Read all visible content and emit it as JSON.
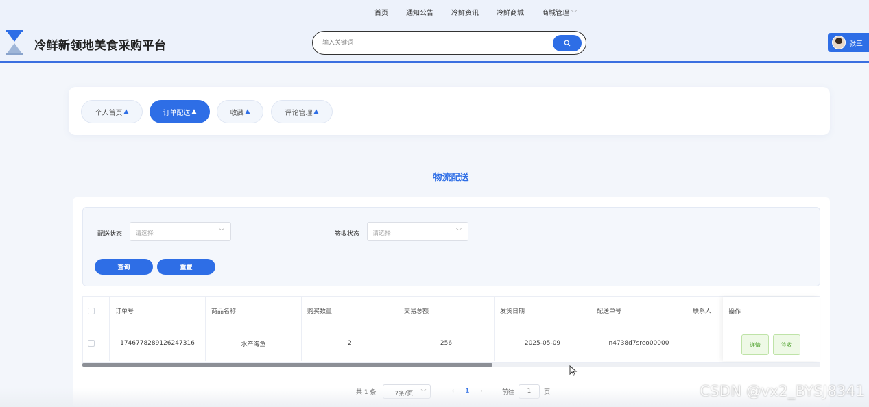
{
  "header": {
    "site_title": "冷鲜新领地美食采购平台",
    "nav": [
      "首页",
      "通知公告",
      "冷鲜资讯",
      "冷鲜商城",
      "商城管理"
    ],
    "search_placeholder": "输入关键词",
    "user_name": "张三"
  },
  "tabs": [
    {
      "label": "个人首页",
      "active": false
    },
    {
      "label": "订单配送",
      "active": true
    },
    {
      "label": "收藏",
      "active": false
    },
    {
      "label": "评论管理",
      "active": false
    }
  ],
  "section_title": "物流配送",
  "filters": {
    "delivery_status_label": "配送状态",
    "delivery_status_placeholder": "请选择",
    "receipt_status_label": "签收状态",
    "receipt_status_placeholder": "请选择",
    "query_label": "查询",
    "reset_label": "重置"
  },
  "table": {
    "columns": [
      "订单号",
      "商品名称",
      "购买数量",
      "交易总额",
      "发货日期",
      "配送单号",
      "联系人",
      "操作"
    ],
    "rows": [
      {
        "order_no": "1746778289126247316",
        "product_name": "水产海鱼",
        "quantity": "2",
        "total": "256",
        "ship_date": "2025-05-09",
        "tracking_no": "n4738d7sreo00000",
        "contact": "",
        "ops": [
          "详情",
          "签收"
        ]
      }
    ]
  },
  "pagination": {
    "total_text": "共 1 条",
    "page_size": "7条/页",
    "current_page": "1",
    "goto_prefix": "前往",
    "goto_value": "1",
    "goto_suffix": "页"
  },
  "watermark": "CSDN @vx2_BYSJ8341",
  "colors": {
    "accent": "#2e6ee6",
    "op_green": "#5aa83a"
  }
}
